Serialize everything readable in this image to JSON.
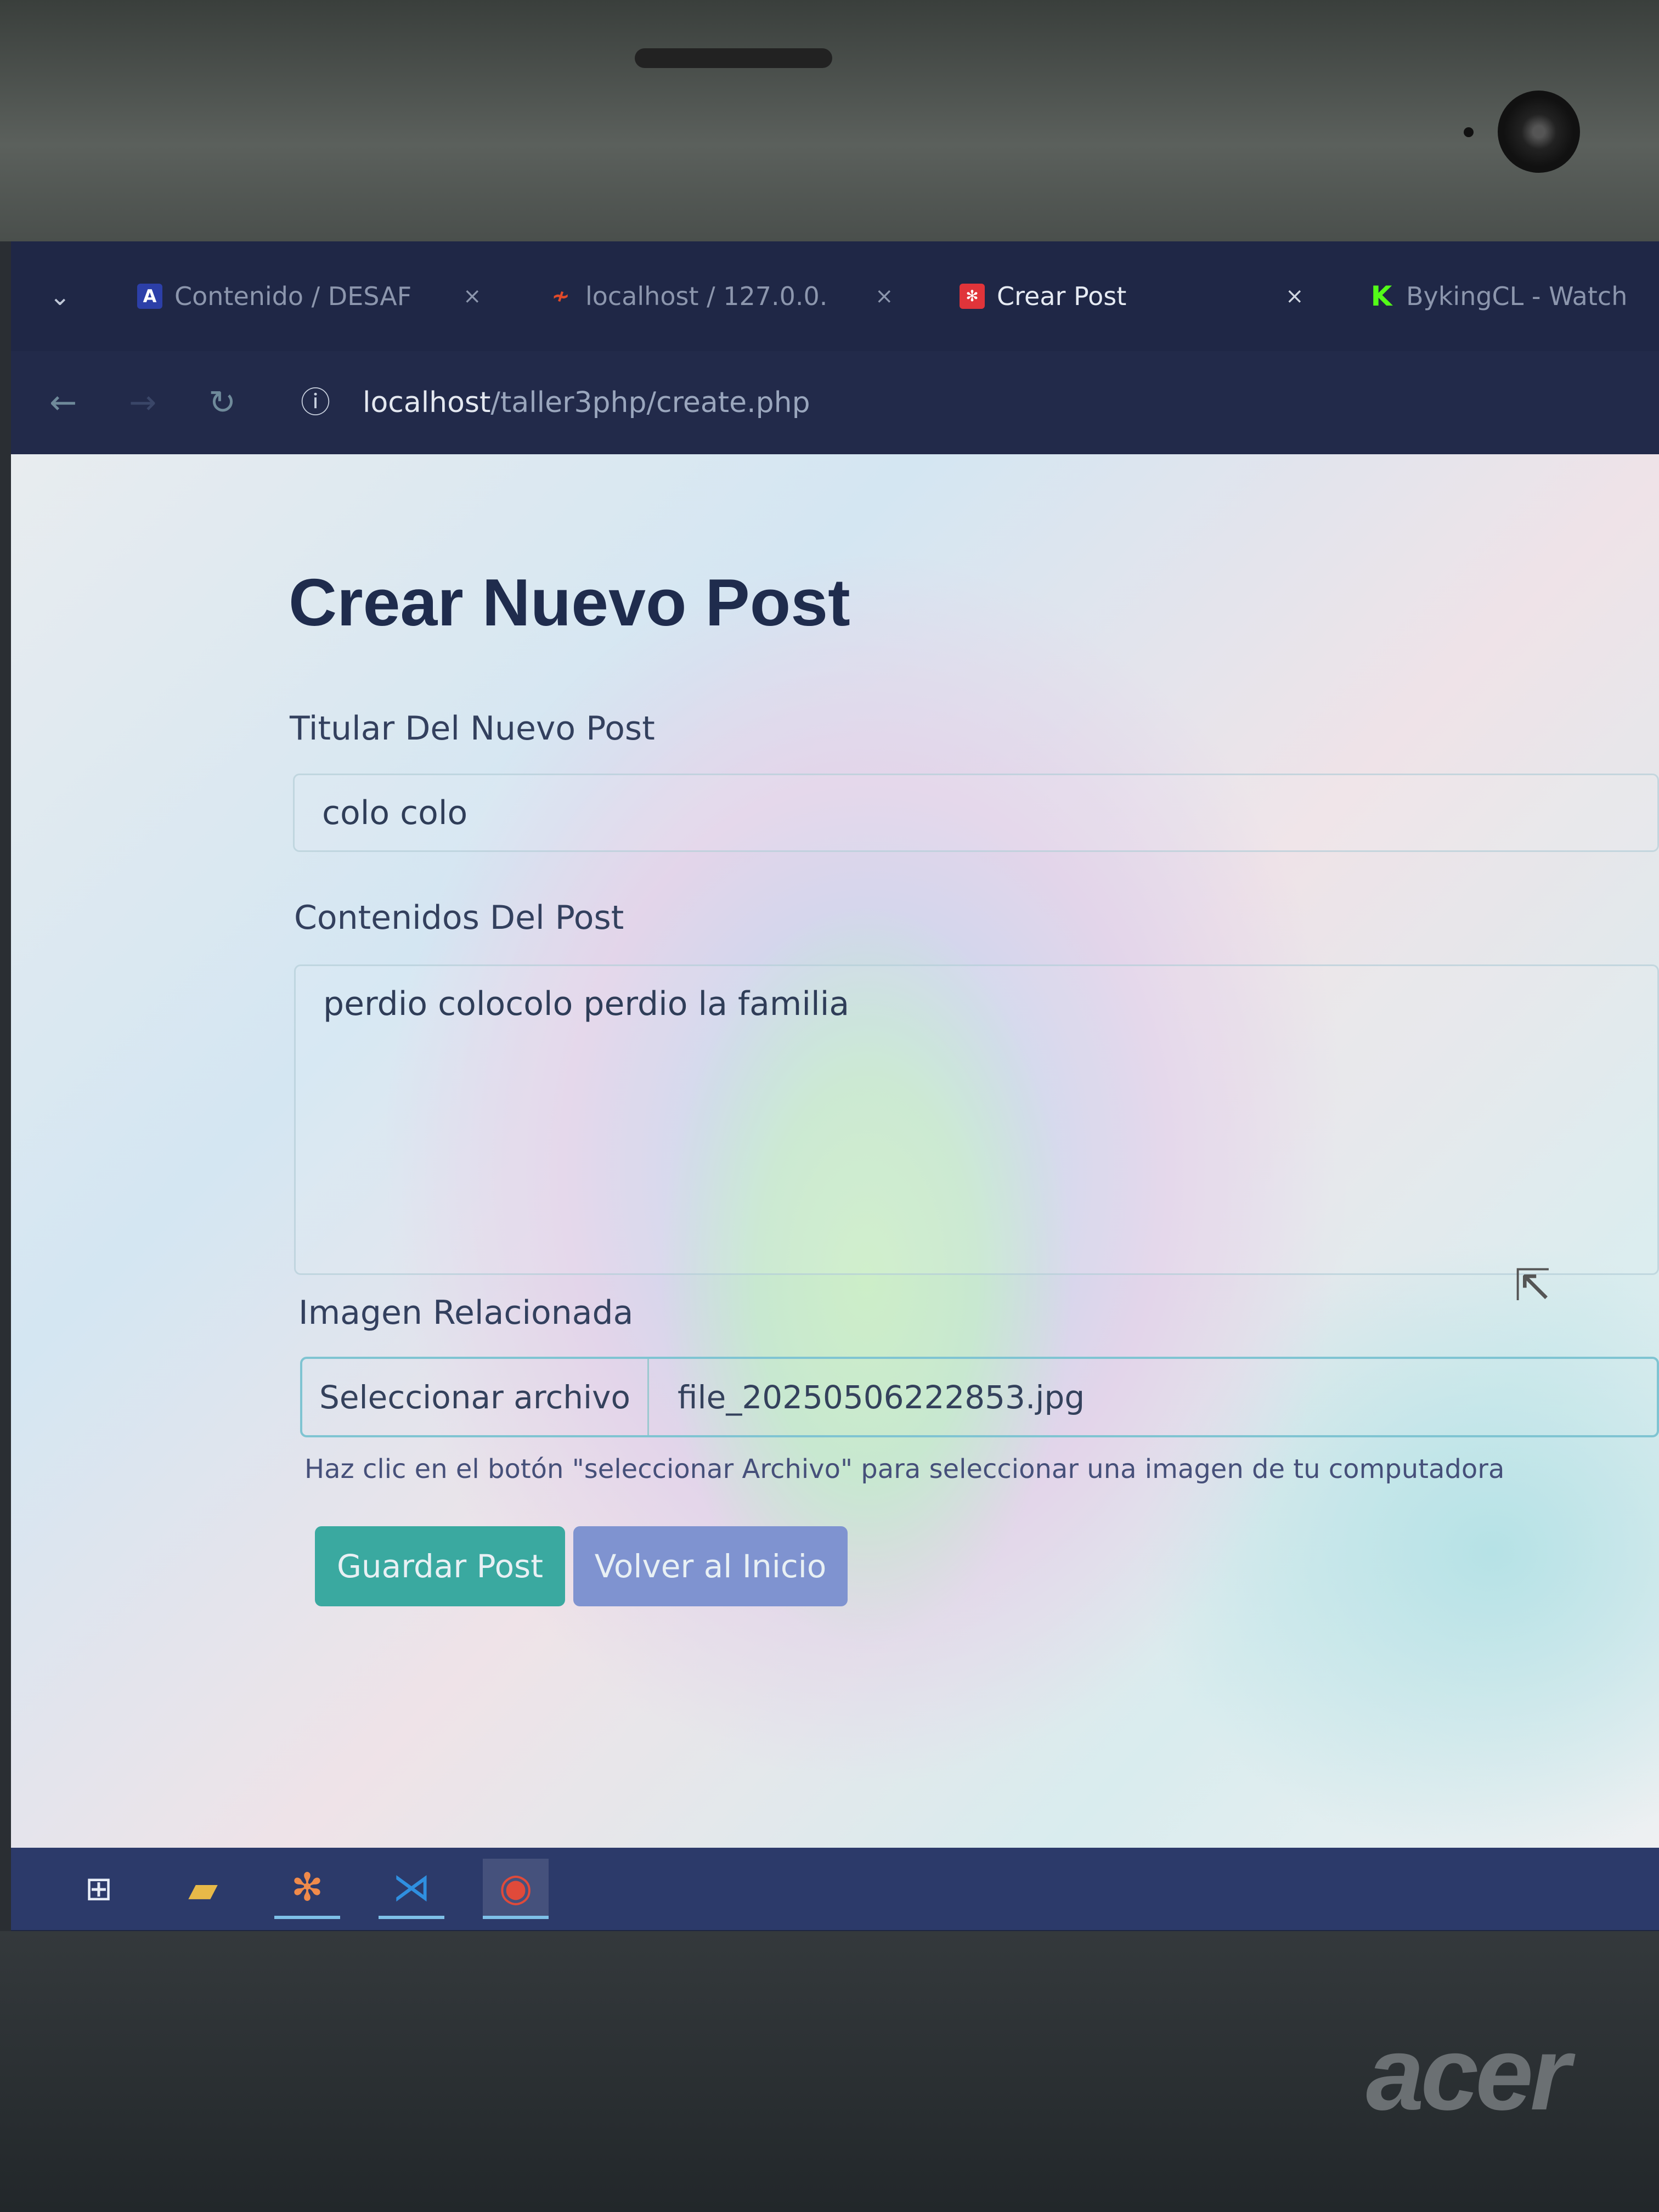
{
  "browser": {
    "tabs": [
      {
        "label": "Contenido / DESAF",
        "icon": "moodle-icon",
        "color": "#2c3fa8",
        "active": false
      },
      {
        "label": "localhost / 127.0.0.",
        "icon": "phpmyadmin-icon",
        "color": "#e04a2a",
        "active": false
      },
      {
        "label": "Crear Post",
        "icon": "xampp-icon",
        "color": "#e0343a",
        "active": true
      },
      {
        "label": "BykingCL - Watch",
        "icon": "kick-icon",
        "color": "#53fc18",
        "active": false
      }
    ],
    "url_host": "localhost",
    "url_path": "/taller3php/create.php"
  },
  "form": {
    "title": "Crear Nuevo Post",
    "headline_label": "Titular Del Nuevo Post",
    "headline_value": "colo colo",
    "content_label": "Contenidos Del Post",
    "content_value": "perdio colocolo perdio la familia",
    "image_label": "Imagen Relacionada",
    "file_button": "Seleccionar archivo",
    "file_name": "file_20250506222853.jpg",
    "help_text": "Haz clic en el botón \"seleccionar Archivo\" para seleccionar una imagen de tu computadora",
    "save_label": "Guardar Post",
    "back_label": "Volver al Inicio",
    "save_color": "#3aa9a0",
    "back_color": "#7f93d0"
  },
  "taskbar": {
    "items": [
      "windows-start-icon",
      "file-explorer-icon",
      "xampp-icon",
      "vscode-icon",
      "chrome-icon"
    ]
  },
  "device": {
    "brand": "acer"
  }
}
